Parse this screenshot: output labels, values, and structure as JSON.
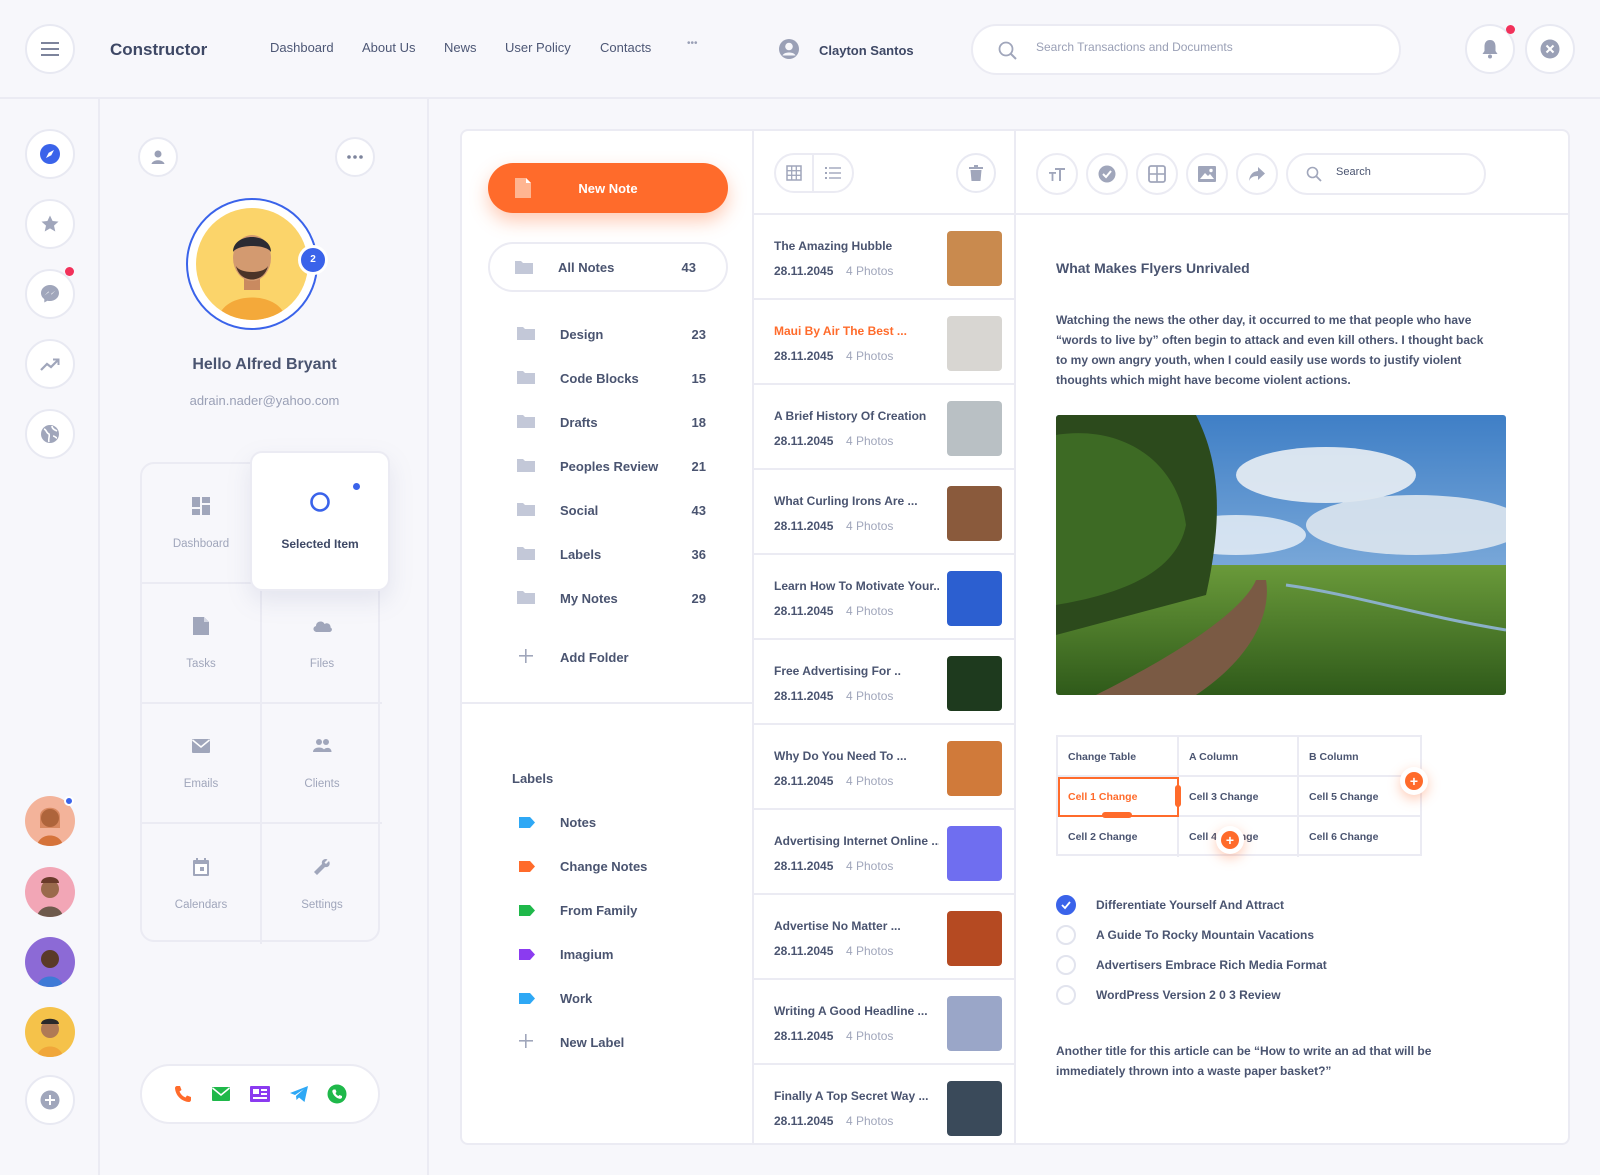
{
  "topbar": {
    "brand": "Constructor",
    "nav": [
      "Dashboard",
      "About Us",
      "News",
      "User Policy",
      "Contacts"
    ],
    "more": "•••",
    "user_name": "Clayton Santos",
    "search_placeholder": "Search Transactions and Documents"
  },
  "profile": {
    "badge_count": "2",
    "greeting": "Hello Alfred Bryant",
    "email": "adrain.nader@yahoo.com",
    "grid": {
      "dashboard": "Dashboard",
      "selected": "Selected Item",
      "tasks": "Tasks",
      "files": "Files",
      "emails": "Emails",
      "clients": "Clients",
      "calendars": "Calendars",
      "settings": "Settings"
    }
  },
  "folders": {
    "new_note": "New Note",
    "all_notes": {
      "label": "All Notes",
      "count": "43"
    },
    "items": [
      {
        "label": "Design",
        "count": "23"
      },
      {
        "label": "Code Blocks",
        "count": "15"
      },
      {
        "label": "Drafts",
        "count": "18"
      },
      {
        "label": "Peoples Review",
        "count": "21"
      },
      {
        "label": "Social",
        "count": "43"
      },
      {
        "label": "Labels",
        "count": "36"
      },
      {
        "label": "My Notes",
        "count": "29"
      }
    ],
    "add_folder": "Add Folder",
    "labels_title": "Labels",
    "labels": [
      {
        "label": "Notes",
        "color": "#2ea8f5"
      },
      {
        "label": "Change Notes",
        "color": "#ff6b2b"
      },
      {
        "label": "From Family",
        "color": "#1fb84a"
      },
      {
        "label": "Imagium",
        "color": "#8b3bf0"
      },
      {
        "label": "Work",
        "color": "#2ea8f5"
      }
    ],
    "new_label": "New Label"
  },
  "notes": [
    {
      "title": "The Amazing Hubble",
      "date": "28.11.2045",
      "photos": "4 Photos",
      "thumb": "#c98a4e"
    },
    {
      "title": "Maui By Air The Best ...",
      "date": "28.11.2045",
      "photos": "4 Photos",
      "thumb": "#d8d6d2",
      "active": true
    },
    {
      "title": "A Brief History Of Creation",
      "date": "28.11.2045",
      "photos": "4 Photos",
      "thumb": "#b9c0c4"
    },
    {
      "title": "What Curling Irons Are ...",
      "date": "28.11.2045",
      "photos": "4 Photos",
      "thumb": "#8a5a3c"
    },
    {
      "title": "Learn How To Motivate Your...",
      "date": "28.11.2045",
      "photos": "4 Photos",
      "thumb": "#2c5fd0"
    },
    {
      "title": "Free Advertising For ..",
      "date": "28.11.2045",
      "photos": "4 Photos",
      "thumb": "#1e3a1e"
    },
    {
      "title": "Why Do You Need To ...",
      "date": "28.11.2045",
      "photos": "4 Photos",
      "thumb": "#d07a3a"
    },
    {
      "title": "Advertising Internet Online ...",
      "date": "28.11.2045",
      "photos": "4 Photos",
      "thumb": "#6f6ef0"
    },
    {
      "title": "Advertise No Matter ...",
      "date": "28.11.2045",
      "photos": "4 Photos",
      "thumb": "#b54a22"
    },
    {
      "title": "Writing A Good Headline ...",
      "date": "28.11.2045",
      "photos": "4 Photos",
      "thumb": "#9aa6c8"
    },
    {
      "title": "Finally A Top Secret Way ...",
      "date": "28.11.2045",
      "photos": "4 Photos",
      "thumb": "#3a4a5a"
    }
  ],
  "editor": {
    "search_placeholder": "Search",
    "title": "What Makes Flyers Unrivaled",
    "body": "Watching the news the other day, it occurred to me that people who have “words to live by” often begin to attack and even kill others. I thought back to my own angry youth, when I could easily use words to justify violent thoughts which might have become violent actions.",
    "table": [
      [
        "Change Table",
        "A Column",
        "B Column"
      ],
      [
        "Cell 1 Change",
        "Cell 3 Change",
        "Cell 5 Change"
      ],
      [
        "Cell 2 Change",
        "Cell 4 Change",
        "Cell 6 Change"
      ]
    ],
    "checklist": [
      {
        "label": "Differentiate Yourself And Attract",
        "checked": true
      },
      {
        "label": "A Guide To Rocky Mountain Vacations",
        "checked": false
      },
      {
        "label": "Advertisers Embrace Rich Media Format",
        "checked": false
      },
      {
        "label": "WordPress Version 2 0 3 Review",
        "checked": false
      }
    ],
    "footer": "Another title for this article can be “How to write an ad that will be immediately thrown into a waste paper basket?”"
  },
  "colors": {
    "accent": "#ff6b2b",
    "primary": "#3a63ea",
    "border": "#ebebf3",
    "text": "#4a5470"
  }
}
